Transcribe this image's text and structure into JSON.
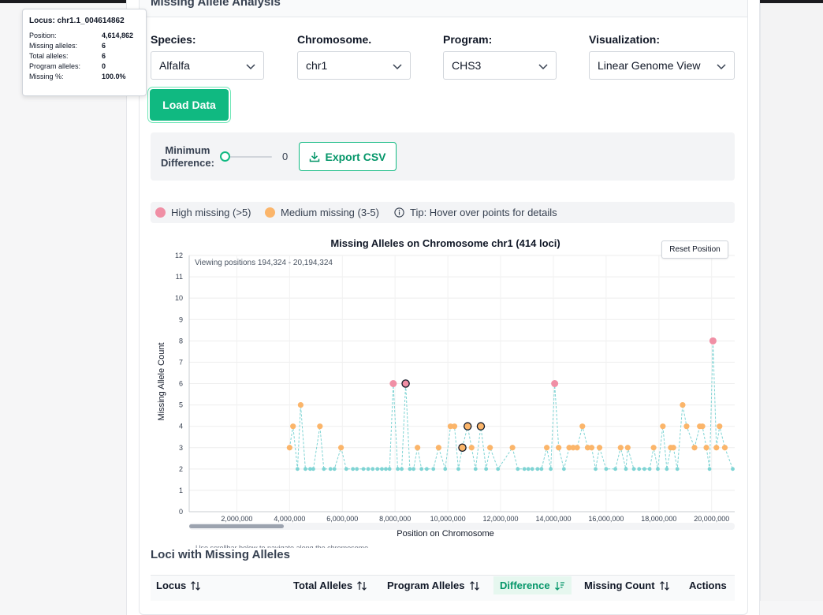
{
  "section_title": "Missing Allele Analysis",
  "filters": {
    "species": {
      "label": "Species:",
      "value": "Alfalfa"
    },
    "chromosome": {
      "label": "Chromosome.",
      "value": "chr1"
    },
    "program": {
      "label": "Program:",
      "value": "CHS3"
    },
    "visualization": {
      "label": "Visualization:",
      "value": "Linear Genome View"
    }
  },
  "load_button": "Load Data",
  "min_difference": {
    "label_line1": "Minimum",
    "label_line2": "Difference:",
    "value": "0"
  },
  "export_button": "Export CSV",
  "legend": {
    "high": "High missing (>5)",
    "medium": "Medium missing (3-5)",
    "tip": "Tip: Hover over points for details"
  },
  "colors": {
    "high": "#f08fa5",
    "medium": "#fbb56a",
    "low": "#7fd4d4",
    "accent": "#10b981"
  },
  "reset_button": "Reset Position",
  "viewing_text": "Viewing positions 194,324 - 20,194,324",
  "scroll_hint": "Use scrollbar below to navigate along the chromosome",
  "tooltip": {
    "title": "Locus: chr1.1_004614862",
    "rows": [
      {
        "label": "Position:",
        "value": "4,614,862"
      },
      {
        "label": "Missing alleles:",
        "value": "6"
      },
      {
        "label": "Total alleles:",
        "value": "6"
      },
      {
        "label": "Program alleles:",
        "value": "0"
      },
      {
        "label": "Missing %:",
        "value": "100.0%"
      }
    ]
  },
  "loci_title": "Loci with Missing Alleles",
  "table_headers": [
    "Locus",
    "Total Alleles",
    "Program Alleles",
    "Difference",
    "Missing Count",
    "Actions"
  ],
  "chart_data": {
    "type": "scatter",
    "title": "Missing Alleles on Chromosome chr1 (414 loci)",
    "xlabel": "Position on Chromosome",
    "ylabel": "Missing Allele Count",
    "xlim": [
      194324,
      20194324
    ],
    "ylim": [
      0,
      12
    ],
    "x_ticks": [
      "2,000,000",
      "4,000,000",
      "6,000,000",
      "8,000,000",
      "10,000,000",
      "12,000,000",
      "14,000,000",
      "16,000,000",
      "18,000,000",
      "20,000,000"
    ],
    "x_tick_values": [
      2000000,
      4000000,
      6000000,
      8000000,
      10000000,
      12000000,
      14000000,
      16000000,
      18000000,
      20000000
    ],
    "y_ticks": [
      0,
      1,
      2,
      3,
      4,
      5,
      6,
      7,
      8,
      9,
      10,
      11,
      12
    ],
    "series_points": [
      [
        4000000,
        3
      ],
      [
        4130000,
        4
      ],
      [
        4300000,
        2
      ],
      [
        4420000,
        5
      ],
      [
        4600000,
        2
      ],
      [
        4780000,
        2
      ],
      [
        4900000,
        2
      ],
      [
        5150000,
        4
      ],
      [
        5300000,
        2
      ],
      [
        5550000,
        2
      ],
      [
        5700000,
        2
      ],
      [
        5950000,
        3
      ],
      [
        6150000,
        2
      ],
      [
        6400000,
        2
      ],
      [
        6550000,
        2
      ],
      [
        6800000,
        2
      ],
      [
        6980000,
        2
      ],
      [
        7150000,
        2
      ],
      [
        7330000,
        2
      ],
      [
        7500000,
        2
      ],
      [
        7650000,
        2
      ],
      [
        7790000,
        2
      ],
      [
        7930000,
        6
      ],
      [
        8100000,
        2
      ],
      [
        8250000,
        2
      ],
      [
        8400000,
        6
      ],
      [
        8560000,
        2
      ],
      [
        8700000,
        2
      ],
      [
        8850000,
        3
      ],
      [
        9000000,
        2
      ],
      [
        9200000,
        2
      ],
      [
        9450000,
        2
      ],
      [
        9650000,
        3
      ],
      [
        9900000,
        2
      ],
      [
        10100000,
        4
      ],
      [
        10250000,
        4
      ],
      [
        10400000,
        2
      ],
      [
        10550000,
        3
      ],
      [
        10750000,
        4
      ],
      [
        10900000,
        3
      ],
      [
        11050000,
        2
      ],
      [
        11250000,
        4
      ],
      [
        11450000,
        2
      ],
      [
        11600000,
        3
      ],
      [
        11900000,
        2
      ],
      [
        12450000,
        3
      ],
      [
        12650000,
        2
      ],
      [
        12900000,
        2
      ],
      [
        13050000,
        2
      ],
      [
        13200000,
        2
      ],
      [
        13400000,
        2
      ],
      [
        13550000,
        2
      ],
      [
        13750000,
        3
      ],
      [
        13900000,
        2
      ],
      [
        14050000,
        6
      ],
      [
        14200000,
        3
      ],
      [
        14400000,
        2
      ],
      [
        14600000,
        3
      ],
      [
        14750000,
        3
      ],
      [
        14900000,
        3
      ],
      [
        15100000,
        4
      ],
      [
        15300000,
        3
      ],
      [
        15450000,
        3
      ],
      [
        15600000,
        2
      ],
      [
        15750000,
        3
      ],
      [
        16000000,
        2
      ],
      [
        16350000,
        2
      ],
      [
        16550000,
        3
      ],
      [
        16750000,
        2
      ],
      [
        16820000,
        3
      ],
      [
        17050000,
        2
      ],
      [
        17250000,
        2
      ],
      [
        17450000,
        2
      ],
      [
        17650000,
        2
      ],
      [
        17800000,
        3
      ],
      [
        17960000,
        2
      ],
      [
        18150000,
        4
      ],
      [
        18300000,
        2
      ],
      [
        18450000,
        3
      ],
      [
        18550000,
        3
      ],
      [
        18700000,
        2
      ],
      [
        18900000,
        5
      ],
      [
        19050000,
        4
      ],
      [
        19350000,
        3
      ],
      [
        19550000,
        4
      ],
      [
        19650000,
        4
      ],
      [
        19800000,
        3
      ],
      [
        19920000,
        2
      ],
      [
        20050000,
        8
      ],
      [
        20180000,
        3
      ],
      [
        20300000,
        4
      ],
      [
        20500000,
        3
      ],
      [
        20800000,
        2
      ]
    ],
    "highlighted_points": [
      [
        8400000,
        6
      ],
      [
        10550000,
        3
      ],
      [
        10750000,
        4
      ],
      [
        11250000,
        4
      ]
    ],
    "grid": true
  }
}
